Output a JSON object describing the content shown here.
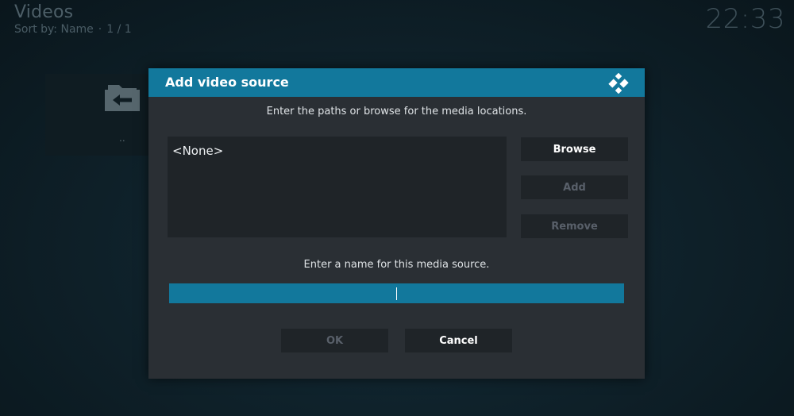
{
  "header": {
    "title": "Videos",
    "sort_label": "Sort by: Name",
    "separator": "·",
    "page": "1 / 1",
    "clock": "22:33"
  },
  "background": {
    "tile_label": ".."
  },
  "dialog": {
    "title": "Add video source",
    "logo_icon": "kodi-logo-icon",
    "instruction_paths": "Enter the paths or browse for the media locations.",
    "paths": [
      "<None>"
    ],
    "buttons": {
      "browse": "Browse",
      "add": "Add",
      "remove": "Remove",
      "ok": "OK",
      "cancel": "Cancel"
    },
    "instruction_name": "Enter a name for this media source.",
    "name_value": ""
  },
  "colors": {
    "accent": "#12789c",
    "dialog_bg": "#2a2f34",
    "control_bg": "#1f2428",
    "disabled_text": "#59606a"
  }
}
